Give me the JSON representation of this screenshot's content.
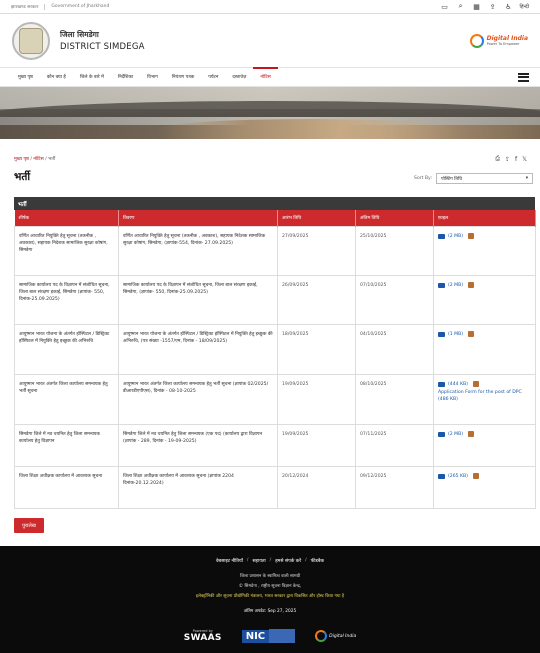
{
  "topbar": {
    "left_items": [
      "झारखण्ड सरकार",
      "Government of Jharkhand"
    ],
    "lang_label": "हिन्दी"
  },
  "header": {
    "title_hi": "जिला सिमडेगा",
    "title_en": "DISTRICT SIMDEGA",
    "digital_india": "Digital India",
    "digital_india_tag": "Power To Empower"
  },
  "nav": {
    "items": [
      "मुख्य पृष्ठ",
      "कौन क्या है",
      "जिले के बारे में",
      "निर्देशिका",
      "विभाग",
      "नियंत्रण पत्रक",
      "पर्यटन",
      "दस्तावेज़",
      "नोटिस"
    ],
    "active_index": 8
  },
  "breadcrumb": {
    "home": "मुख्य पृष्ठ",
    "parent": "नोटिस",
    "current": "भर्ती"
  },
  "page": {
    "title": "भर्ती",
    "sort_label": "Sort By:",
    "sort_value": "पोस्टिंग तिथि"
  },
  "table": {
    "caption": "भर्ती",
    "headers": [
      "शीर्षक",
      "विवरण",
      "आरंभ तिथि",
      "अंतिम तिथि",
      "फ़ाइल"
    ],
    "rows": [
      {
        "title": "वर्णित आधारित नियुक्ति हेतु सूचना (तकनीक , अवकाश), सहायक निदेशक सामाजिक सुरक्षा कोषांग, सिमडेगा",
        "desc": "वर्णित आधारित नियुक्ति हेतु सूचना (तकनीक , अवकाश), सहायक निदेशक सामाजिक सुरक्षा कोषांग, सिमडेगा, (ज्ञापांक-554, दिनांक- 27.09.2025)",
        "start": "27/09/2025",
        "end": "25/10/2025",
        "file": "(2 MB)",
        "extra": ""
      },
      {
        "title": "सामाजिक कार्यालय पद के विज्ञापन में संशोधित सूचना, जिला बाल संरक्षण इकाई, सिमडेगा (ज्ञापांक- 550, दिनांक-25.09.2025)",
        "desc": "सामाजिक कार्यालय पद के विज्ञापन में संशोधित सूचना, जिला बाल संरक्षण इकाई, सिमडेगा, (ज्ञापांक- 550, दिनांक-25.09.2025)",
        "start": "26/09/2025",
        "end": "07/10/2025",
        "file": "(2 MB)",
        "extra": ""
      },
      {
        "title": "आयुष्मान भारत योजना के अंतर्गत हॉस्पिटल / डिस्ट्रिक्ट हॉस्पिटल में नियुक्ति हेतु इच्छुक की अभिरुचि",
        "desc": "आयुष्मान भारत योजना के अंतर्गत हॉस्पिटल / डिस्ट्रिक्ट हॉस्पिटल में नियुक्ति हेतु इच्छुक की अभिरुचि, (पत्र संख्या -1557/एम, दिनांक - 18/09/2025)",
        "start": "18/09/2025",
        "end": "04/10/2025",
        "file": "(1 MB)",
        "extra": ""
      },
      {
        "title": "आयुष्मान भारत अंतर्गत जिला कार्यालय समन्वयक हेतु भर्ती सूचना",
        "desc": "आयुष्मान भारत अंतर्गत जिला कार्यालय समन्वयक हेतु भर्ती सूचना (ज्ञापांक 02/2025/डीआरडीएपीएस), दिनांक - 08-10-2025",
        "start": "19/09/2025",
        "end": "08/10/2025",
        "file": "(444 KB)",
        "extra": "Application Form for the post of DPC (486 KB)"
      },
      {
        "title": "सिमडेगा जिले में नव चयनित हेतु जिला समन्वयक कार्यालय हेतु विज्ञापन",
        "desc": "सिमडेगा जिले में नव चयनित हेतु जिला समन्वयक (एक पद) (कार्यालय द्वारा विज्ञापन (ज्ञापांक - 289, दिनांक - 19-09-2025)",
        "start": "19/09/2025",
        "end": "07/11/2025",
        "file": "(2 MB)",
        "extra": ""
      },
      {
        "title": "जिला शिक्षा अधीक्षक कार्यालय में आवश्यक सूचना",
        "desc": "जिला शिक्षा अधीक्षक कार्यालय में आवश्यक सूचना (ज्ञापांक 2204 दिनांक-20.12.2024)",
        "start": "20/12/2024",
        "end": "09/12/2025",
        "file": "(265 KB)",
        "extra": ""
      }
    ]
  },
  "back_button": "पुरालेख",
  "footer": {
    "links": [
      "वेबसाइट नीतियाँ",
      "सहायता",
      "हमसे संपर्क करें",
      "फीडबैक"
    ],
    "line1": "जिला प्रशासन के स्वामित्व वाली सामग्री",
    "line2": "© सिमडेगा , राष्ट्रीय सूचना विज्ञान केन्द्र,",
    "line3": "इलेक्ट्रॉनिकी और सूचना प्रौद्योगिकी मंत्रालय, भारत सरकार द्वारा विकसित और होस्ट किया गया है",
    "updated": "अंतिम अपडेट: Sep 27, 2025",
    "swaas_powered": "Powered by",
    "swaas_name": "SWAAS",
    "nic": "NIC",
    "digital_india": "Digital India"
  }
}
